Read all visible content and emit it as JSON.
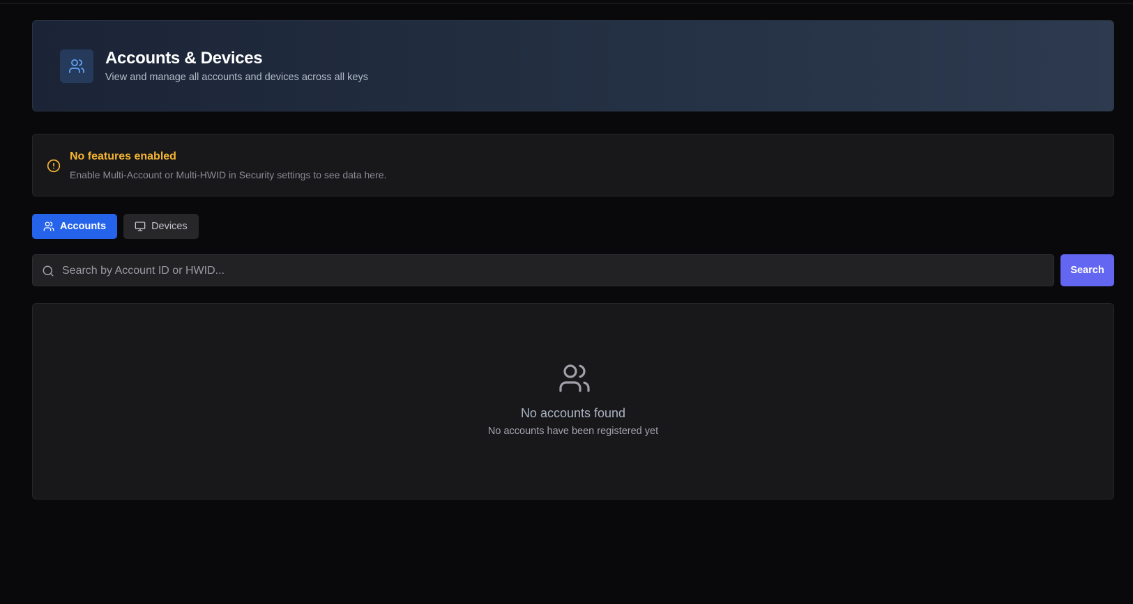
{
  "header": {
    "icon": "users-icon",
    "title": "Accounts & Devices",
    "subtitle": "View and manage all accounts and devices across all keys"
  },
  "notice": {
    "icon": "alert-circle-icon",
    "title": "No features enabled",
    "text": "Enable Multi-Account or Multi-HWID in Security settings to see data here.",
    "color": "#f5b531"
  },
  "tabs": [
    {
      "label": "Accounts",
      "icon": "users-icon",
      "active": true
    },
    {
      "label": "Devices",
      "icon": "monitor-icon",
      "active": false
    }
  ],
  "search": {
    "placeholder": "Search by Account ID or HWID...",
    "value": "",
    "button_label": "Search"
  },
  "empty_state": {
    "icon": "users-icon",
    "title": "No accounts found",
    "text": "No accounts have been registered yet"
  },
  "colors": {
    "background": "#09090b",
    "accent_blue": "#2563eb",
    "search_button": "#6366f1",
    "warning": "#f5b531"
  }
}
